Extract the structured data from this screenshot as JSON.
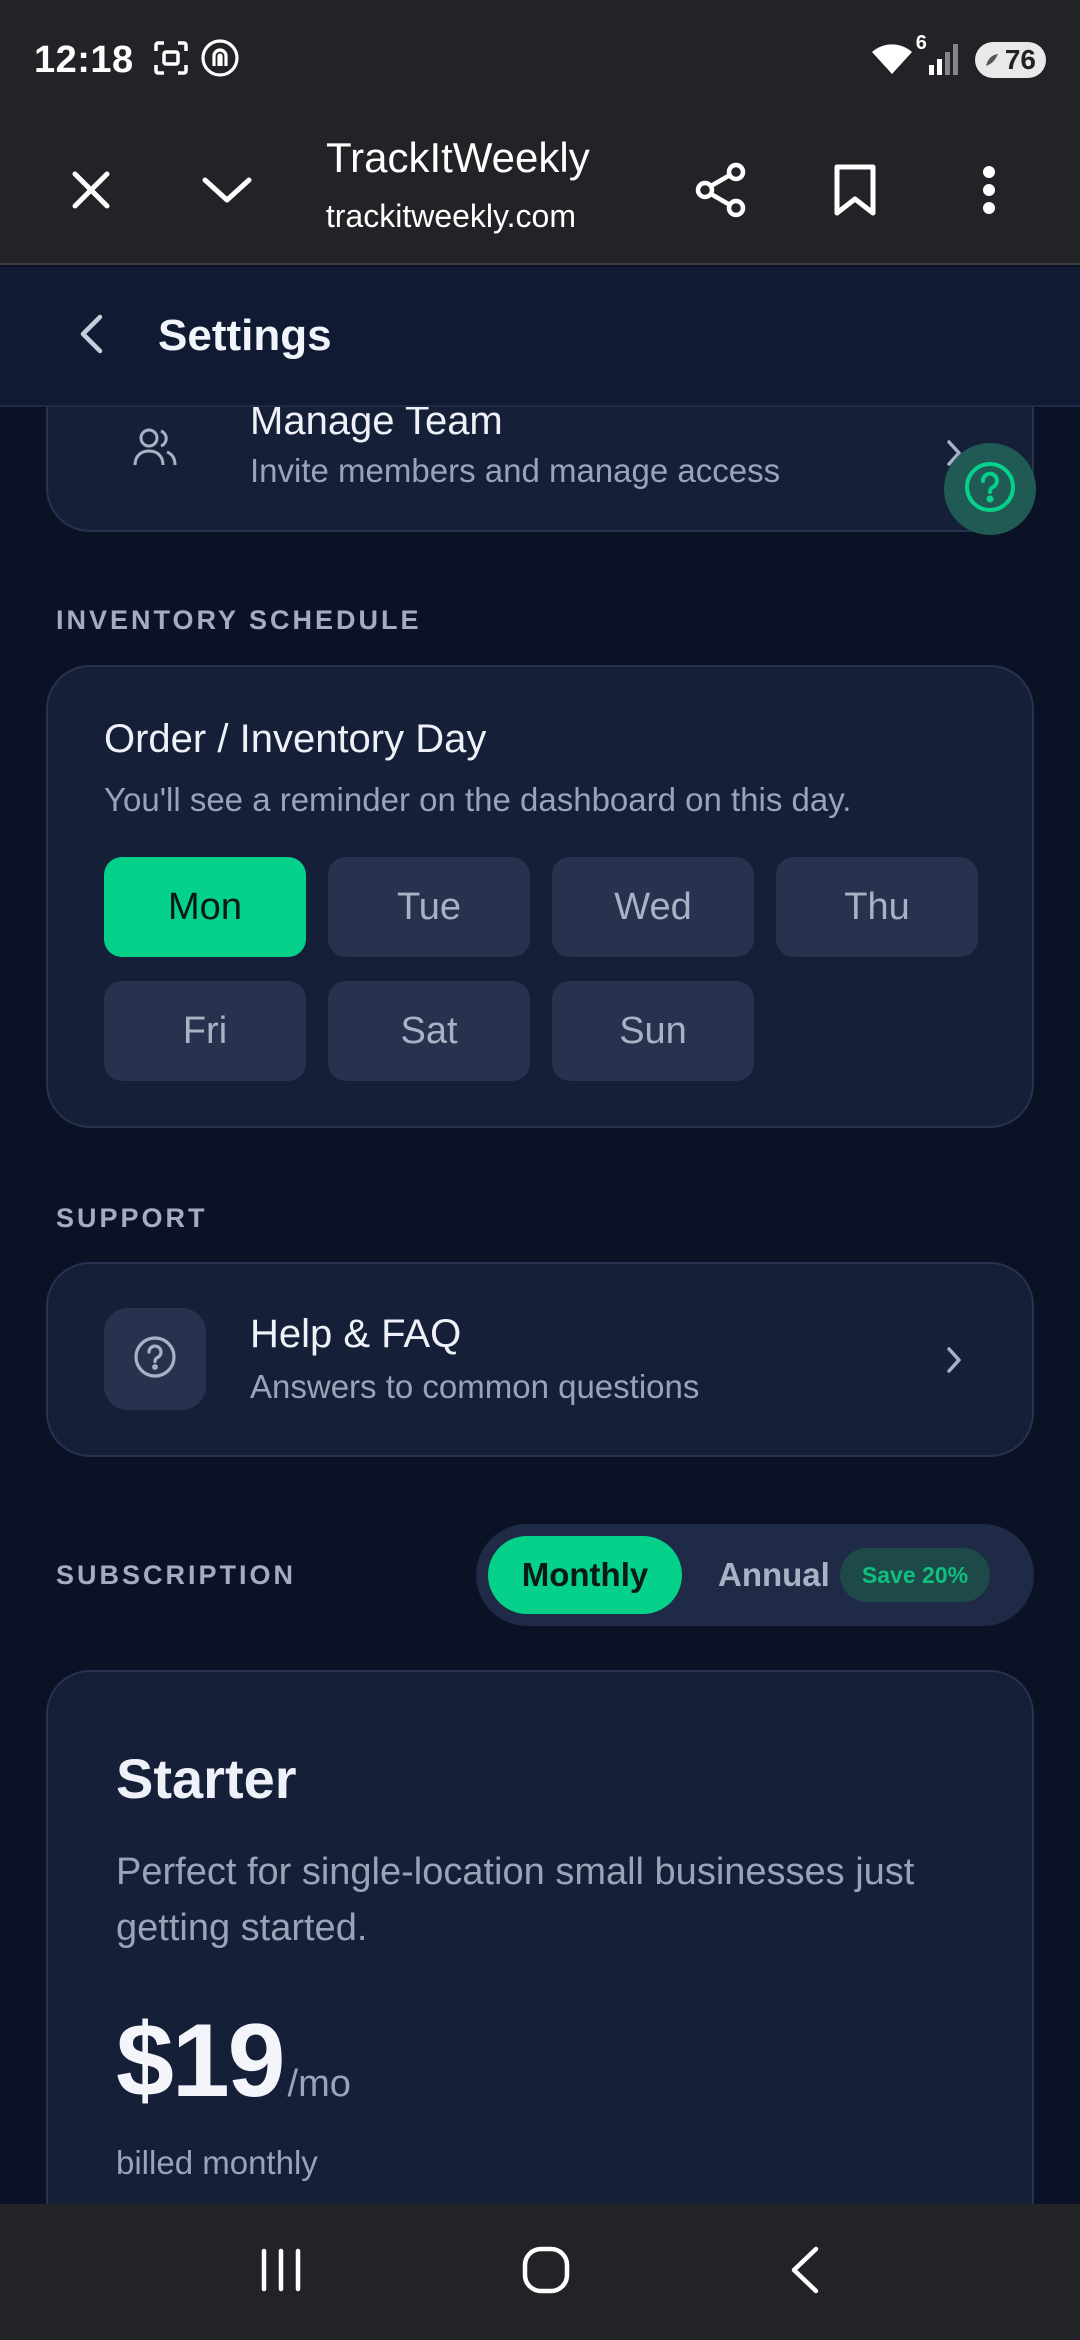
{
  "status_bar": {
    "time": "12:18",
    "network_label": "6",
    "battery": "76",
    "icons": [
      "screenshot-icon",
      "nfc-icon",
      "wifi-icon",
      "signal-icon",
      "battery-icon"
    ]
  },
  "browser": {
    "title": "TrackItWeekly",
    "url": "trackitweekly.com",
    "icons": [
      "close-icon",
      "chevron-down-icon",
      "share-icon",
      "bookmark-icon",
      "more-vert-icon"
    ]
  },
  "header": {
    "title": "Settings"
  },
  "manage_team": {
    "title": "Manage Team",
    "subtitle": "Invite members and manage access"
  },
  "inventory": {
    "section_label": "INVENTORY SCHEDULE",
    "title": "Order / Inventory Day",
    "subtitle": "You'll see a reminder on the dashboard on this day.",
    "days": [
      "Mon",
      "Tue",
      "Wed",
      "Thu",
      "Fri",
      "Sat",
      "Sun"
    ],
    "selected": "Mon"
  },
  "support": {
    "section_label": "SUPPORT",
    "title": "Help & FAQ",
    "subtitle": "Answers to common questions"
  },
  "subscription": {
    "section_label": "SUBSCRIPTION",
    "toggle_monthly": "Monthly",
    "toggle_annual": "Annual",
    "save_badge": "Save 20%",
    "plan_name": "Starter",
    "plan_desc": "Perfect for single-location small businesses just getting started.",
    "price": "$19",
    "price_unit": "/mo",
    "billing": "billed monthly"
  },
  "colors": {
    "accent": "#05d18a",
    "background": "#0b1226",
    "card": "#161f38"
  }
}
